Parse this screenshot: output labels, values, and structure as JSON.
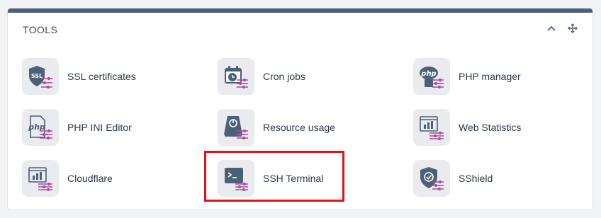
{
  "panel": {
    "title": "TOOLS"
  },
  "header_icons": {
    "collapse": "chevron-up-icon",
    "move": "move-arrows-icon"
  },
  "tools": [
    {
      "label": "SSL certificates",
      "icon": "ssl-shield-icon"
    },
    {
      "label": "Cron jobs",
      "icon": "calendar-clock-icon"
    },
    {
      "label": "PHP manager",
      "icon": "php-badge-icon"
    },
    {
      "label": "PHP INI Editor",
      "icon": "php-file-icon"
    },
    {
      "label": "Resource usage",
      "icon": "disk-usage-icon"
    },
    {
      "label": "Web Statistics",
      "icon": "statistics-chart-icon"
    },
    {
      "label": "Cloudflare",
      "icon": "cloudflare-chart-icon"
    },
    {
      "label": "SSH Terminal",
      "icon": "terminal-icon"
    },
    {
      "label": "SShield",
      "icon": "shield-check-icon"
    }
  ],
  "colors": {
    "icon_primary": "#4c6178",
    "icon_accent": "#b0479c",
    "highlight": "#e4101a",
    "topbar": "#4c6178"
  },
  "highlighted_tool": "SSH Terminal"
}
